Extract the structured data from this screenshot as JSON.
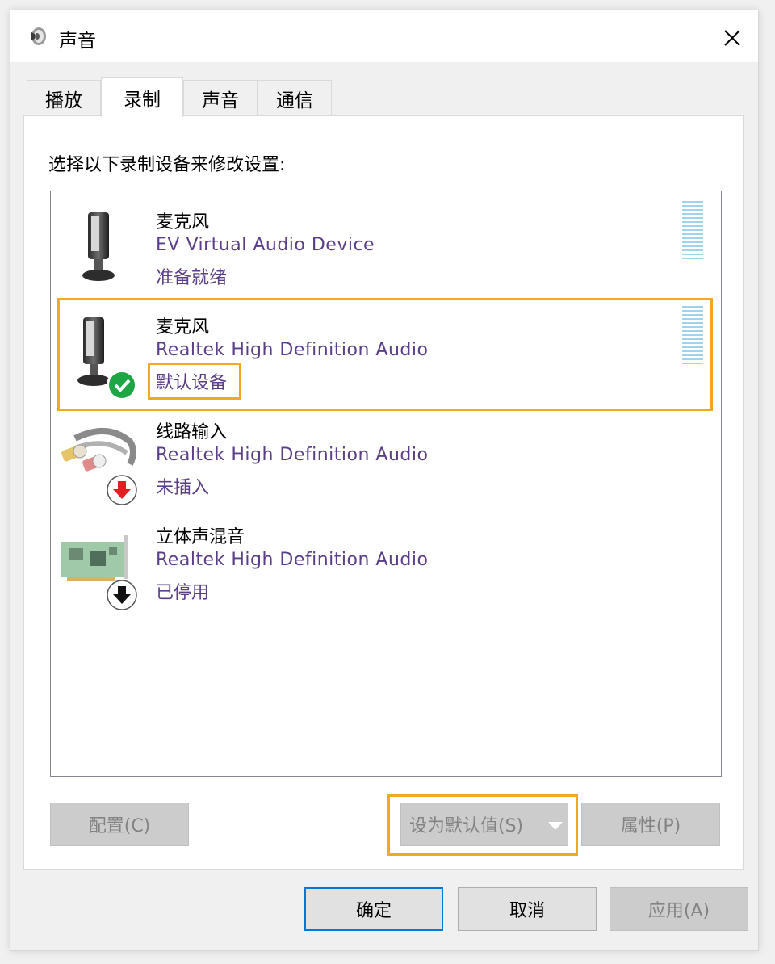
{
  "window": {
    "title": "声音",
    "icon": "speaker-icon",
    "close_icon": "close-icon"
  },
  "tabs": [
    {
      "label": "播放",
      "active": false
    },
    {
      "label": "录制",
      "active": true
    },
    {
      "label": "声音",
      "active": false
    },
    {
      "label": "通信",
      "active": false
    }
  ],
  "instruction": "选择以下录制设备来修改设置:",
  "devices": [
    {
      "name": "麦克风",
      "description": "EV Virtual Audio Device",
      "status": "准备就绪",
      "icon": "microphone-icon",
      "badge": null,
      "level_meter": true,
      "highlighted": false
    },
    {
      "name": "麦克风",
      "description": "Realtek High Definition Audio",
      "status": "默认设备",
      "icon": "microphone-icon",
      "badge": "check-badge-icon",
      "level_meter": true,
      "highlighted": true
    },
    {
      "name": "线路输入",
      "description": "Realtek High Definition Audio",
      "status": "未插入",
      "icon": "rca-cable-icon",
      "badge": "red-down-arrow-icon",
      "level_meter": false,
      "highlighted": false
    },
    {
      "name": "立体声混音",
      "description": "Realtek High Definition Audio",
      "status": "已停用",
      "icon": "sound-card-icon",
      "badge": "black-down-arrow-icon",
      "level_meter": false,
      "highlighted": false
    }
  ],
  "panel_buttons": {
    "configure": "配置(C)",
    "set_default": "设为默认值(S)",
    "properties": "属性(P)"
  },
  "dialog_buttons": {
    "ok": "确定",
    "cancel": "取消",
    "apply": "应用(A)"
  },
  "colors": {
    "highlight": "#f5a623",
    "device_text": "#5b3e8a",
    "meter": "#9fd3ec",
    "primary_border": "#0078d7"
  }
}
